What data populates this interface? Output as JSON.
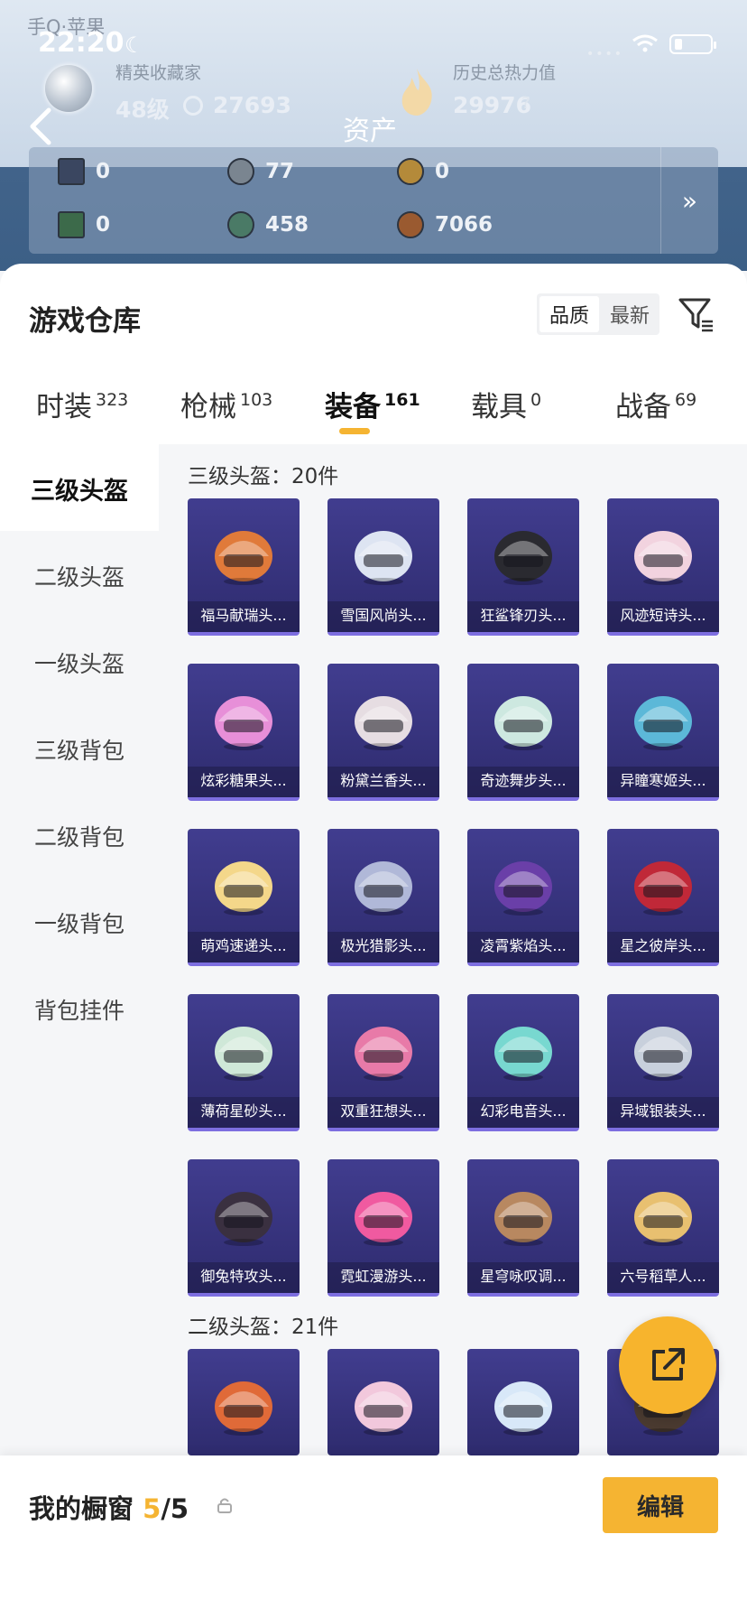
{
  "status": {
    "carrier": "手Q·苹果",
    "time": "22:20"
  },
  "header": {
    "title": "资产",
    "left_label": "精英收藏家",
    "level": "48级",
    "points": "27693",
    "right_label": "历史总热力值",
    "heat": "29976",
    "heat_help": "?"
  },
  "assets": [
    {
      "icon": "card-icon",
      "value": "0"
    },
    {
      "icon": "silver-coin-icon",
      "value": "77"
    },
    {
      "icon": "gold-coin-icon",
      "value": "0"
    },
    {
      "icon": "green-card-icon",
      "value": "0"
    },
    {
      "icon": "gem-icon",
      "value": "458"
    },
    {
      "icon": "bronze-coin-icon",
      "value": "7066"
    }
  ],
  "assets_more": "»",
  "warehouse": {
    "title": "游戏仓库",
    "sort_selected": "品质",
    "sort_other": "最新"
  },
  "tabs": [
    {
      "label": "时装",
      "count": "323"
    },
    {
      "label": "枪械",
      "count": "103"
    },
    {
      "label": "装备",
      "count": "161"
    },
    {
      "label": "载具",
      "count": "0"
    },
    {
      "label": "战备",
      "count": "69"
    }
  ],
  "categories": [
    "三级头盔",
    "二级头盔",
    "一级头盔",
    "三级背包",
    "二级背包",
    "一级背包",
    "背包挂件"
  ],
  "section1": {
    "header": "三级头盔：20件"
  },
  "items": [
    "福马献瑞头...",
    "雪国风尚头...",
    "狂鲨锋刃头...",
    "风迹短诗头...",
    "炫彩糖果头...",
    "粉黛兰香头...",
    "奇迹舞步头...",
    "异瞳寒姬头...",
    "萌鸡速递头...",
    "极光猎影头...",
    "凌霄紫焰头...",
    "星之彼岸头...",
    "薄荷星砂头...",
    "双重狂想头...",
    "幻彩电音头...",
    "异域银装头...",
    "御兔特攻头...",
    "霓虹漫游头...",
    "星穹咏叹调...",
    "六号稻草人..."
  ],
  "item_colors": [
    "#e07a3a",
    "#dde4f2",
    "#2a2a30",
    "#f2d3df",
    "#e78fd8",
    "#e6dde2",
    "#cde8e0",
    "#5cb8d8",
    "#f4d78a",
    "#b0b8d8",
    "#6a3fa8",
    "#c02838",
    "#cfe8d8",
    "#e87aa8",
    "#78d8d0",
    "#c8d0dc",
    "#3a3040",
    "#f05aa0",
    "#b88860",
    "#e8c070"
  ],
  "section2": {
    "header": "二级头盔：21件"
  },
  "items2_colors": [
    "#e06a38",
    "#f2c8dc",
    "#d8e8f8",
    "#4a3a30"
  ],
  "showcase": {
    "label": "我的橱窗",
    "current": "5",
    "total": "/5"
  },
  "edit_label": "编辑"
}
